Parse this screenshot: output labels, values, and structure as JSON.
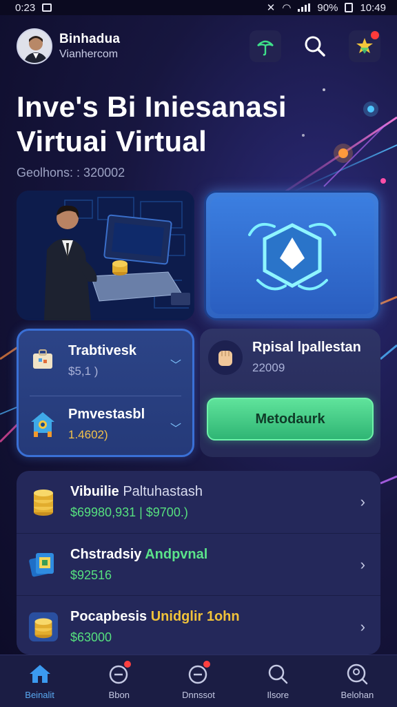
{
  "status_bar": {
    "time_left": "0:23",
    "battery": "90%",
    "time_right": "10:49"
  },
  "header": {
    "user_name": "Binhadua",
    "user_sub": "Vianhercom"
  },
  "title": {
    "line1": "Inve's Bi Iniesanasi",
    "line2": "Virtuai Virtual"
  },
  "subtitle": "Geolhons: : 320002",
  "invest_card": {
    "rows": [
      {
        "label": "Trabtivesk",
        "value": "$5,1 )"
      },
      {
        "label": "Pmvestasbl",
        "value": "1.4602)"
      }
    ]
  },
  "rp_card": {
    "label": "Rpisal lpallestan",
    "value": "22009",
    "button_label": "Metodaurk"
  },
  "list": [
    {
      "title_a": "Vibuilie",
      "title_b": "Paltuhastash",
      "value": "$69980,931 | $9700.)"
    },
    {
      "title_a": "Chstradsiy",
      "title_b": "Andpvnal",
      "value": "$92516"
    },
    {
      "title_a": "Pocapbesis",
      "title_b": "Unidglir 1ohn",
      "value": "$63000"
    }
  ],
  "tabs": [
    {
      "label": "Beinalit"
    },
    {
      "label": "Bbon"
    },
    {
      "label": "Dnnssot"
    },
    {
      "label": "Ilsore"
    },
    {
      "label": "Belohan"
    }
  ]
}
